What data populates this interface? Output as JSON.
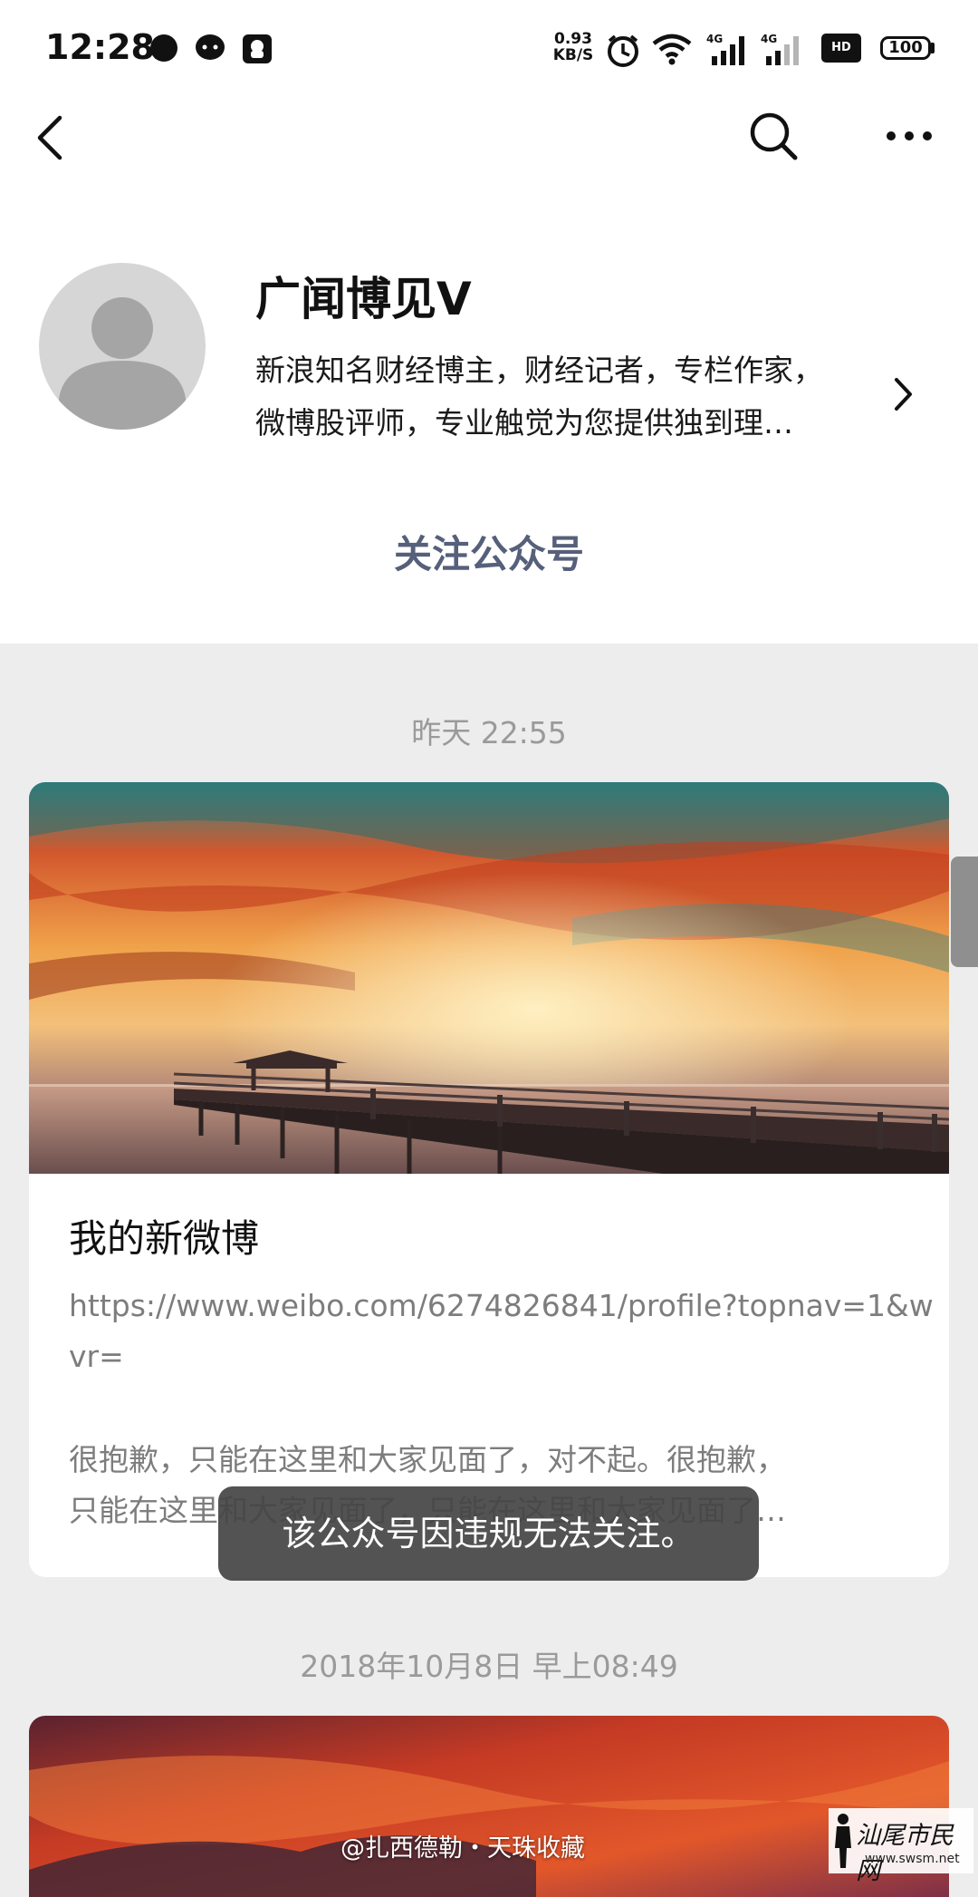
{
  "status_bar": {
    "time": "12:28",
    "speed_value": "0.93",
    "speed_unit": "KB/S",
    "network_1": "4G",
    "network_2": "4G",
    "hd": "HD",
    "battery": "100"
  },
  "account": {
    "name": "广闻博见V",
    "description_line1": "新浪知名财经博主，财经记者，专栏作家，",
    "description_line2": "微博股评师，专业触觉为您提供独到理…",
    "follow_label": "关注公众号"
  },
  "messages": [
    {
      "timestamp": "昨天 22:55",
      "title": "我的新微博",
      "link": "https://www.weibo.com/6274826841/profile?topnav=1&wvr=",
      "body_line1": "很抱歉，只能在这里和大家见面了，对不起。很抱歉，",
      "body_line2": "只能在这里和大家见面了，只能在这里和大家见面了…"
    },
    {
      "timestamp": "2018年10月8日 早上08:49"
    }
  ],
  "toast": "该公众号因违规无法关注。",
  "watermark": "@扎西德勒・天珠收藏",
  "site_logo": {
    "name": "汕尾市民网",
    "url": "www.swsm.net"
  },
  "colors": {
    "follow": "#56607a",
    "page_bg": "#ededed",
    "card_bg": "#ffffff",
    "toast_bg": "#444444"
  },
  "icons": [
    "back-arrow-icon",
    "search-icon",
    "more-icon",
    "chevron-right-icon"
  ]
}
